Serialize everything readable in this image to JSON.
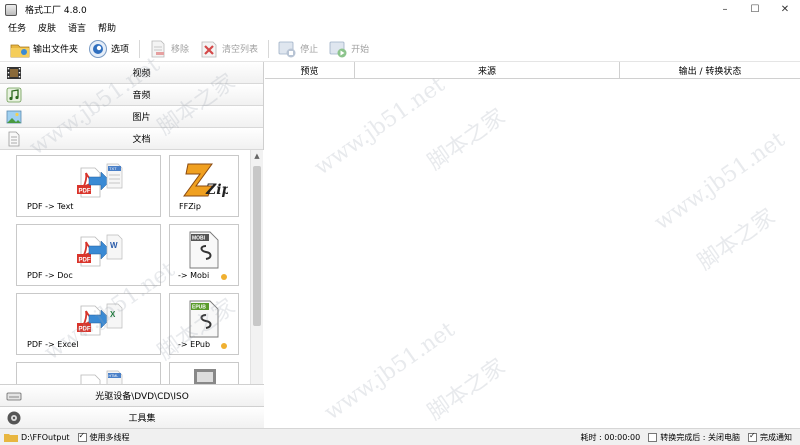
{
  "window": {
    "title": "格式工厂 4.8.0",
    "controls": [
      "–",
      "☐",
      "✕"
    ]
  },
  "menu": [
    "任务",
    "皮肤",
    "语言",
    "帮助"
  ],
  "toolbar": {
    "output_folder": "输出文件夹",
    "options": "选项",
    "remove": "移除",
    "clear_list": "清空列表",
    "stop": "停止",
    "start": "开始"
  },
  "categories": {
    "video": "视频",
    "audio": "音频",
    "image": "图片",
    "document": "文档",
    "disc": "光驱设备\\DVD\\CD\\ISO",
    "tools": "工具集"
  },
  "cards": [
    {
      "label": "PDF -> Text"
    },
    {
      "label": "FFZip"
    },
    {
      "label": "PDF -> Doc"
    },
    {
      "label": "-> Mobi"
    },
    {
      "label": "PDF -> Excel"
    },
    {
      "label": "-> EPub"
    }
  ],
  "card_icon_text": {
    "pdf": "PDF",
    "txt": "TXT",
    "doc": "W",
    "xls": "X",
    "html": "HTML",
    "mobi": "MOBI",
    "epub": "EPUB",
    "zip": "Zip"
  },
  "table": {
    "columns": [
      "预览",
      "来源",
      "输出 / 转换状态"
    ]
  },
  "status": {
    "output_path": "D:\\FFOutput",
    "multithread": "使用多线程",
    "elapsed": "耗时 : 00:00:00",
    "after_done": "转换完成后 : 关闭电脑",
    "notify": "完成通知"
  },
  "watermark": {
    "url": "www.jb51.net",
    "site": "脚本之家"
  },
  "colors": {
    "pdf_red": "#d9342b",
    "arrow_blue": "#3a8ad4",
    "accent_orange": "#f0b030"
  }
}
